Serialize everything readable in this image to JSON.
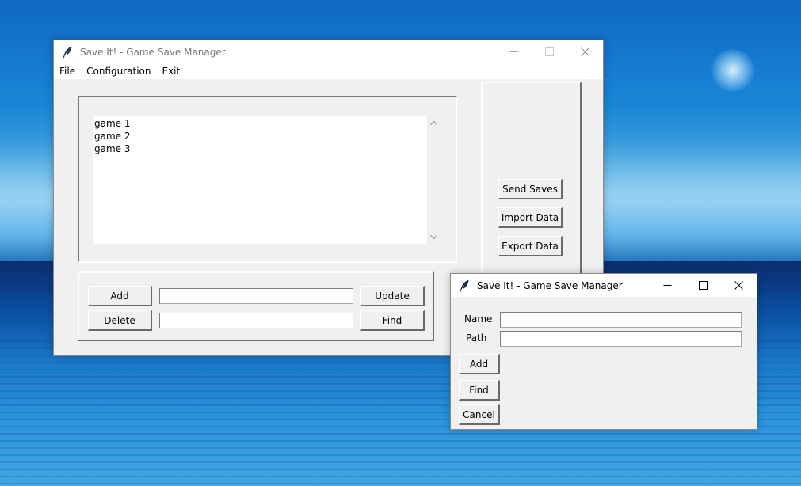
{
  "main_window": {
    "title": "Save It! - Game Save Manager",
    "menu": [
      "File",
      "Configuration",
      "Exit"
    ],
    "games": [
      "game 1",
      "game 2",
      "game 3"
    ],
    "buttons": {
      "add": "Add",
      "delete": "Delete",
      "update": "Update",
      "find": "Find",
      "send_saves": "Send Saves",
      "import_data": "Import Data",
      "export_data": "Export Data"
    },
    "entry_top_value": "",
    "entry_bottom_value": ""
  },
  "dialog": {
    "title": "Save It! - Game Save Manager",
    "name_label": "Name",
    "path_label": "Path",
    "name_value": "",
    "path_value": "",
    "buttons": {
      "add": "Add",
      "find": "Find",
      "cancel": "Cancel"
    }
  },
  "icons": {
    "app": "feather-icon",
    "minimize": "minimize-icon",
    "maximize": "maximize-icon",
    "close": "close-icon",
    "scroll_up": "chevron-up-icon",
    "scroll_down": "chevron-down-icon"
  }
}
